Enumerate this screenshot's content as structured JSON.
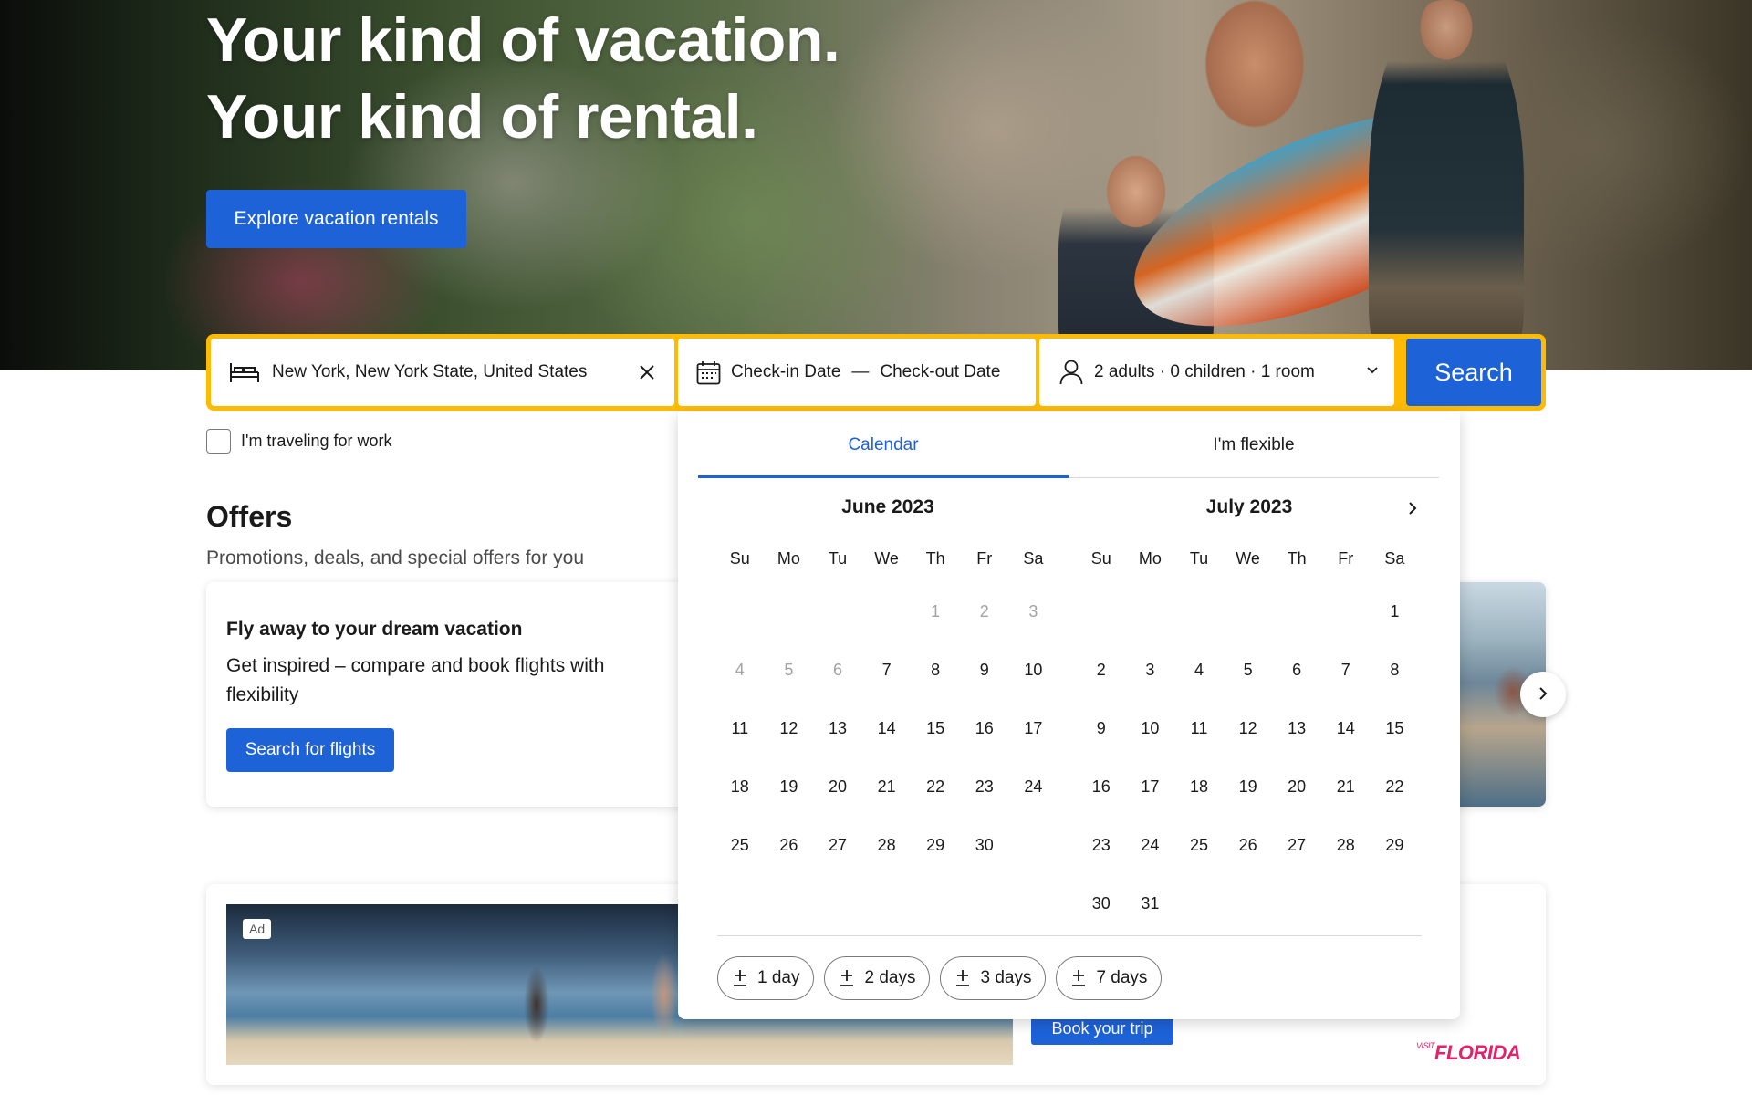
{
  "hero": {
    "title_line1": "Your kind of vacation.",
    "title_line2": "Your kind of rental.",
    "cta_label": "Explore vacation rentals"
  },
  "search": {
    "destination_value": "New York, New York State, United States",
    "checkin_placeholder": "Check-in Date",
    "date_separator": "—",
    "checkout_placeholder": "Check-out Date",
    "guests_value": "2 adults · 0 children · 1 room",
    "search_label": "Search",
    "work_travel_label": "I'm traveling for work",
    "work_travel_checked": false
  },
  "offers": {
    "title": "Offers",
    "subtitle": "Promotions, deals, and special offers for you",
    "card_title": "Fly away to your dream vacation",
    "card_desc": "Get inspired – compare and book flights with flexibility",
    "card_button": "Search for flights"
  },
  "ad": {
    "badge": "Ad",
    "button": "Book your trip",
    "logo_small": "VISIT",
    "logo": "FLORIDA"
  },
  "datepicker": {
    "tabs": [
      "Calendar",
      "I'm flexible"
    ],
    "active_tab": "Calendar",
    "weekdays": [
      "Su",
      "Mo",
      "Tu",
      "We",
      "Th",
      "Fr",
      "Sa"
    ],
    "months": [
      {
        "title": "June 2023",
        "first_weekday": 4,
        "days": 30,
        "past_through": 6
      },
      {
        "title": "July 2023",
        "first_weekday": 6,
        "days": 31,
        "past_through": 0
      }
    ],
    "quick_add": [
      "1 day",
      "2 days",
      "3 days",
      "7 days"
    ]
  },
  "icons": {
    "destination": "bed-icon",
    "clear": "close-icon",
    "dates": "calendar-icon",
    "guests": "person-icon",
    "dropdown": "chevron-down-icon",
    "next": "chevron-right-icon",
    "add": "plus-icon"
  },
  "colors": {
    "brand_blue": "#1e62d8",
    "search_border": "#febb02",
    "florida_pink": "#e2226a"
  }
}
